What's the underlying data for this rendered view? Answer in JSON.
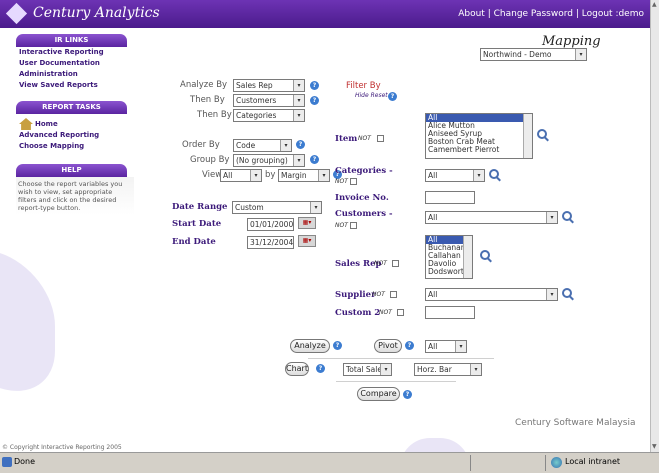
{
  "header": {
    "title": "Century Analytics",
    "links": [
      "About",
      "Change Password",
      "Logout :demo"
    ],
    "separator": "|"
  },
  "sidebar": {
    "ir_links": {
      "title": "IR LINKS",
      "items": [
        "Interactive Reporting",
        "User Documentation",
        "Administration",
        "View Saved Reports"
      ]
    },
    "tasks": {
      "title": "REPORT TASKS",
      "items": [
        "Home",
        "Advanced Reporting",
        "Choose Mapping"
      ]
    },
    "help": {
      "title": "HELP",
      "text": "Choose the report variables you wish to view, set appropriate filters and click on the desired report-type button."
    },
    "copyright": "© Copyright Interactive Reporting 2005"
  },
  "mapping": {
    "title": "Mapping",
    "value": "Northwind - Demo"
  },
  "analysis": {
    "analyze_by_label": "Analyze By",
    "analyze_by_value": "Sales Rep",
    "then_by_label_1": "Then By",
    "then_by_value_1": "Customers",
    "then_by_label_2": "Then By",
    "then_by_value_2": "Categories",
    "order_by_label": "Order By",
    "order_by_value": "Code",
    "group_by_label": "Group By",
    "group_by_value": "(No grouping)",
    "view_label": "View",
    "view_value": "All",
    "by_label": "by",
    "by_value": "Margin"
  },
  "dates": {
    "range_label": "Date Range",
    "range_value": "Custom",
    "start_label": "Start Date",
    "start_value": "01/01/2000",
    "end_label": "End Date",
    "end_value": "31/12/2004"
  },
  "filter": {
    "title": "Filter By",
    "hide_reset": "Hide Reset",
    "not_label": "NOT",
    "item_label": "Item",
    "item_options": [
      "All",
      "Alice Mutton",
      "Aniseed Syrup",
      "Boston Crab Meat",
      "Camembert Pierrot"
    ],
    "categories_label": "Categories -",
    "categories_value": "All",
    "invoice_label": "Invoice No.",
    "invoice_value": "",
    "customers_label": "Customers -",
    "customers_value": "All",
    "salesrep_label": "Sales Rep",
    "salesrep_options": [
      "All",
      "Buchanan",
      "Callahan",
      "Davolio",
      "Dodsworth"
    ],
    "supplier_label": "Supplier",
    "supplier_value": "All",
    "custom2_label": "Custom 2",
    "custom2_value": ""
  },
  "actions": {
    "analyze": "Analyze",
    "pivot": "Pivot",
    "pivot_value": "All",
    "chart": "Chart",
    "chart_measure": "Total Sales",
    "chart_type": "Horz. Bar",
    "compare": "Compare"
  },
  "footer_brand": "Century Software Malaysia",
  "status": {
    "text": "Done",
    "zone": "Local intranet"
  }
}
